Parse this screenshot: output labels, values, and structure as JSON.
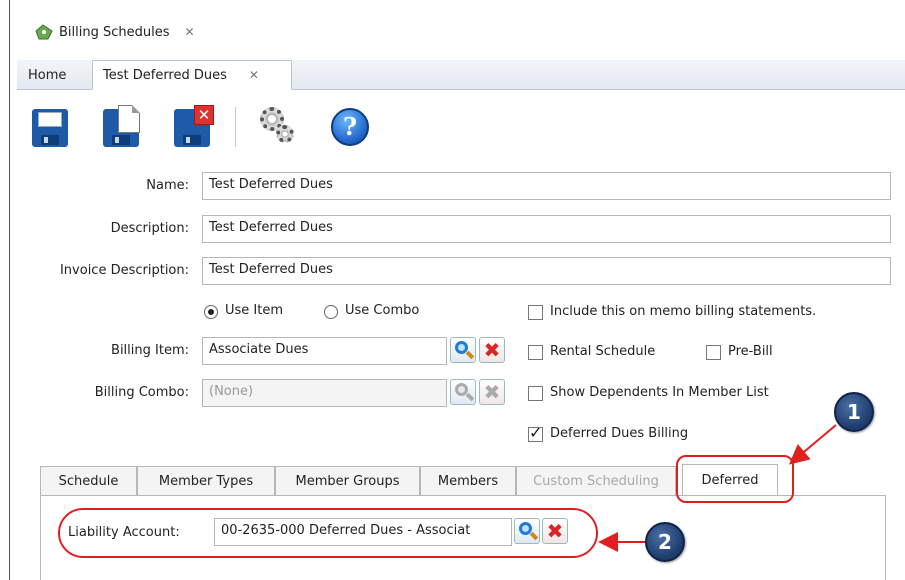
{
  "window": {
    "doc_tab_label": "Billing Schedules",
    "sub_tabs": [
      {
        "label": "Home"
      },
      {
        "label": "Test Deferred Dues"
      }
    ]
  },
  "toolbar": {
    "icons": [
      "save-icon",
      "save-copy-icon",
      "save-close-icon",
      "settings-gears-icon",
      "help-icon"
    ]
  },
  "form": {
    "name_label": "Name:",
    "name_value": "Test Deferred Dues",
    "description_label": "Description:",
    "description_value": "Test Deferred Dues",
    "invoice_description_label": "Invoice Description:",
    "invoice_description_value": "Test Deferred Dues",
    "use_item_label": "Use Item",
    "use_combo_label": "Use Combo",
    "selected_source": "Use Item",
    "billing_item_label": "Billing Item:",
    "billing_item_value": "Associate Dues",
    "billing_combo_label": "Billing Combo:",
    "billing_combo_value": "(None)",
    "checkboxes": {
      "memo_billing": {
        "label": "Include this on memo billing statements.",
        "checked": false
      },
      "rental_schedule": {
        "label": "Rental Schedule",
        "checked": false
      },
      "pre_bill": {
        "label": "Pre-Bill",
        "checked": false
      },
      "show_dependents": {
        "label": "Show Dependents In Member List",
        "checked": false
      },
      "deferred_dues": {
        "label": "Deferred Dues Billing",
        "checked": true
      }
    }
  },
  "bottom_tabs": [
    {
      "label": "Schedule",
      "enabled": true
    },
    {
      "label": "Member Types",
      "enabled": true
    },
    {
      "label": "Member Groups",
      "enabled": true
    },
    {
      "label": "Members",
      "enabled": true
    },
    {
      "label": "Custom Scheduling",
      "enabled": false
    },
    {
      "label": "Deferred",
      "enabled": true,
      "active": true
    }
  ],
  "deferred_panel": {
    "liability_account_label": "Liability Account:",
    "liability_account_value": "00-2635-000 Deferred Dues - Associat"
  },
  "callouts": [
    {
      "number": "1"
    },
    {
      "number": "2"
    }
  ],
  "colors": {
    "callout_red": "#e02020",
    "badge_blue": "#1c3a6a",
    "tab_border": "#b7b7b7"
  }
}
